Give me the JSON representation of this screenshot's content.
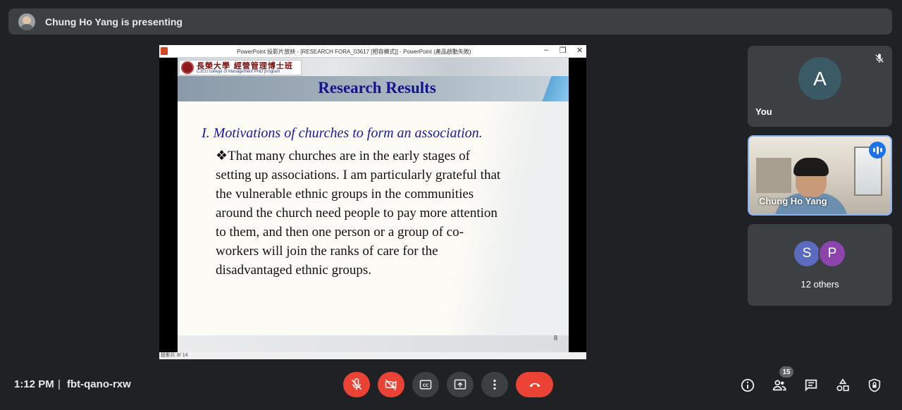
{
  "presenter": {
    "text": "Chung Ho Yang is presenting"
  },
  "screen": {
    "ppt_titlebar": "PowerPoint 投影片放映 - [RESEARCH FORA_03617 [相容模式]] - PowerPoint (產品啟動失敗)",
    "status": "投影片 8/ 14",
    "slide": {
      "logo_cn": "長榮大學 經營管理博士班",
      "logo_en": "CJCU college of Management PHD program",
      "title": "Research Results",
      "heading": "I. Motivations of churches to form an association.",
      "body_lines": [
        "❖That many churches are in the early stages of",
        "setting up associations. I am particularly grateful that",
        "the vulnerable ethnic groups in the communities",
        "around the church need people to pay more attention",
        "to them, and then one person or a group of co-",
        "workers will join the ranks of care for the",
        "disadvantaged ethnic groups."
      ],
      "number": "8"
    }
  },
  "tiles": {
    "you": {
      "initial": "A",
      "label": "You"
    },
    "speaker": {
      "name": "Chung Ho Yang"
    },
    "others": {
      "initials": [
        "S",
        "P"
      ],
      "label": "12 others"
    }
  },
  "bottom": {
    "time": "1:12 PM",
    "separator": "|",
    "meeting_code": "fbt-qano-rxw",
    "participants_count": "15"
  },
  "colors": {
    "accent": "#8ab4f8",
    "danger": "#ea4335",
    "panel": "#3c4043",
    "bg": "#202124"
  }
}
